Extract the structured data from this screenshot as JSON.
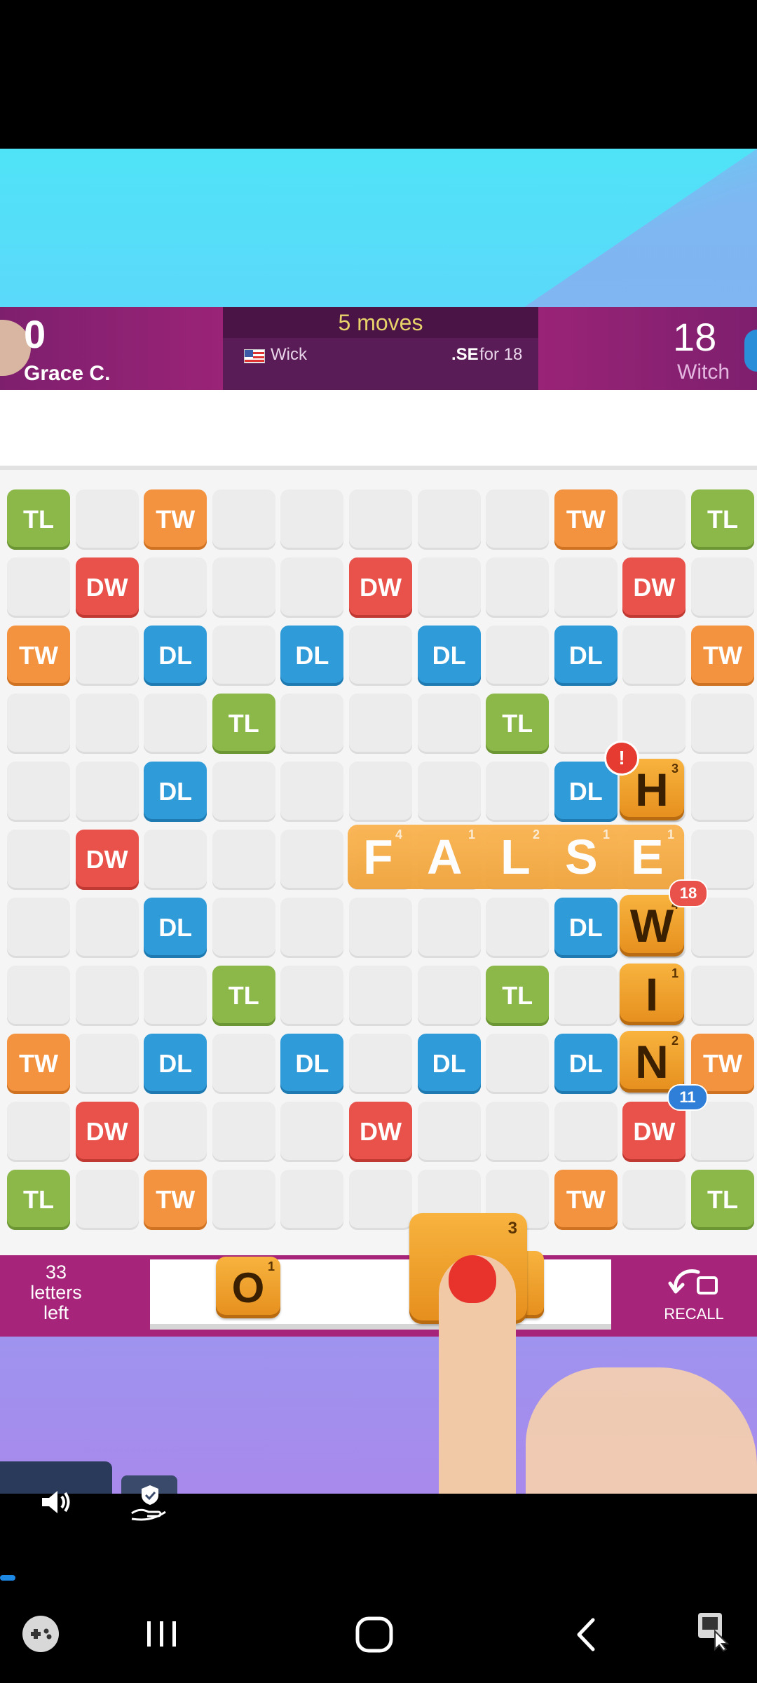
{
  "header": {
    "left_player": {
      "score": "0",
      "name": "Grace C."
    },
    "moves_label": "5 moves",
    "last_move": {
      "player": "Wick",
      "word_suffix": ".SE",
      "points_text": "for 18"
    },
    "right_player": {
      "score": "18",
      "name": "Witch"
    }
  },
  "board": {
    "bonus_labels": {
      "r0c0": "TL",
      "r0c2": "TW",
      "r0c8": "TW",
      "r0c10": "TL",
      "r1c1": "DW",
      "r1c5": "DW",
      "r1c9": "DW",
      "r2c0": "TW",
      "r2c2": "DL",
      "r2c4": "DL",
      "r2c6": "DL",
      "r2c8": "DL",
      "r2c10": "TW",
      "r3c3": "TL",
      "r3c7": "TL",
      "r4c2": "DL",
      "r4c8": "DL",
      "r5c1": "DW",
      "r6c2": "DL",
      "r6c8": "DL",
      "r7c3": "TL",
      "r7c7": "TL",
      "r8c0": "TW",
      "r8c2": "DL",
      "r8c4": "DL",
      "r8c6": "DL",
      "r8c8": "DL",
      "r8c10": "TW",
      "r9c1": "DW",
      "r9c5": "DW",
      "r9c9": "DW",
      "r10c0": "TL",
      "r10c2": "TW",
      "r10c8": "TW",
      "r10c10": "TL"
    },
    "placed_tiles": {
      "h": {
        "letter": "H",
        "points": "3"
      },
      "w": {
        "letter": "W",
        "points": "4"
      },
      "i": {
        "letter": "I",
        "points": "1"
      },
      "n": {
        "letter": "N",
        "points": "2"
      }
    },
    "preview_word": {
      "letters": [
        "F",
        "A",
        "L",
        "S",
        "E"
      ],
      "points": [
        "4",
        "1",
        "2",
        "1",
        "1"
      ]
    },
    "badges": {
      "alert": "!",
      "score_18": "18",
      "score_11": "11"
    }
  },
  "rack": {
    "letters_left": [
      "33",
      "letters",
      "left"
    ],
    "tile_o": {
      "letter": "O",
      "points": "1"
    },
    "dragging_tile_points": "3",
    "recall_label": "RECALL"
  },
  "colors": {
    "TL": "#8cb84a",
    "TW": "#f39340",
    "DL": "#2f9bd8",
    "DW": "#e9524a",
    "header": "#a4257a",
    "tile": "#f8b33e"
  },
  "icons": [
    "speaker-icon",
    "accessibility-hand-icon",
    "game-controller-icon",
    "recents-icon",
    "home-icon",
    "back-icon",
    "screen-record-icon"
  ]
}
